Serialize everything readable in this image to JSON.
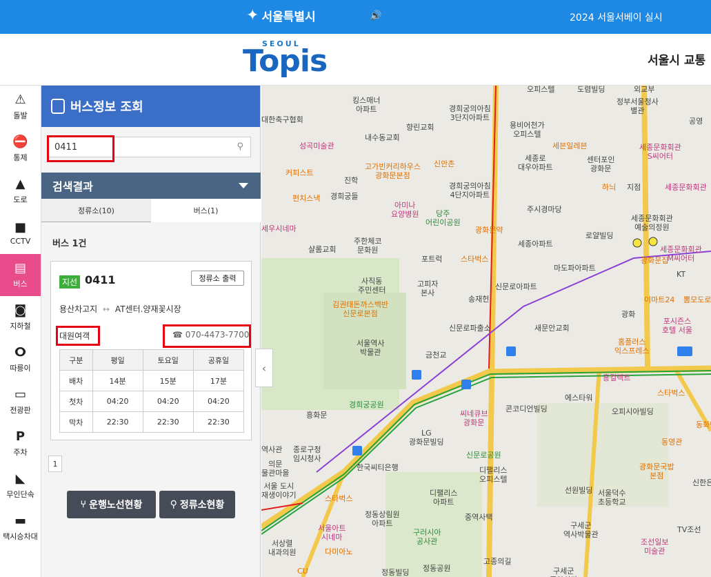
{
  "topbar": {
    "brand": "서울특별시",
    "notice": "2024 서울서베이 실시"
  },
  "header": {
    "logo_small": "SEOUL",
    "logo": "Topis",
    "site_title": "서울시 교통"
  },
  "nav": [
    {
      "label": "돌발",
      "icon": "alert-light-icon"
    },
    {
      "label": "통제",
      "icon": "no-entry-icon"
    },
    {
      "label": "도로",
      "icon": "road-icon"
    },
    {
      "label": "CCTV",
      "icon": "camera-icon"
    },
    {
      "label": "버스",
      "icon": "bus-icon"
    },
    {
      "label": "지하철",
      "icon": "subway-icon"
    },
    {
      "label": "따릉이",
      "icon": "bicycle-icon"
    },
    {
      "label": "전광판",
      "icon": "signboard-icon"
    },
    {
      "label": "주차",
      "icon": "parking-icon"
    },
    {
      "label": "무인단속",
      "icon": "speed-camera-icon"
    },
    {
      "label": "택시승차대",
      "icon": "taxi-icon"
    }
  ],
  "panel": {
    "title": "버스정보 조회",
    "search_value": "0411",
    "results_title": "검색결과",
    "tabs": [
      "정류소(10)",
      "버스(1)"
    ],
    "count": "버스 1건"
  },
  "route": {
    "type": "지선",
    "number": "0411",
    "stop_print": "정류소 출력",
    "start": "용산차고지",
    "arrow": "↔",
    "end": "AT센터.양재꽃시장",
    "company": "대원여객",
    "phone": "070-4473-7700",
    "schedule": {
      "headers": [
        "구분",
        "평일",
        "토요일",
        "공휴일"
      ],
      "rows": [
        [
          "배차",
          "14분",
          "15분",
          "17분"
        ],
        [
          "첫차",
          "04:20",
          "04:20",
          "04:20"
        ],
        [
          "막차",
          "22:30",
          "22:30",
          "22:30"
        ]
      ]
    }
  },
  "pager": {
    "current": "1"
  },
  "buttons": {
    "route_status": "운행노선현황",
    "stop_status": "정류소현황"
  },
  "map": {
    "labels": [
      {
        "text": "오피스텔",
        "class": ""
      },
      {
        "text": "도렴빌딩",
        "class": ""
      },
      {
        "text": "외교부",
        "class": ""
      },
      {
        "text": "킹스매너\n아파트",
        "class": ""
      },
      {
        "text": "경희궁의아침\n3단지아파트",
        "class": ""
      },
      {
        "text": "정부서울청사\n별관",
        "class": ""
      },
      {
        "text": "대한축구협회",
        "class": ""
      },
      {
        "text": "향린교회",
        "class": ""
      },
      {
        "text": "용비어천가\n오피스텔",
        "class": ""
      },
      {
        "text": "공영",
        "class": ""
      },
      {
        "text": "성곡미술관",
        "class": "pink"
      },
      {
        "text": "내수동교회",
        "class": ""
      },
      {
        "text": "세븐일레븐",
        "class": "orange"
      },
      {
        "text": "세종문화회관\nS씨어터",
        "class": "pink"
      },
      {
        "text": "커피스트",
        "class": "orange"
      },
      {
        "text": "고가빈커리하우스\n광화문본점",
        "class": "orange"
      },
      {
        "text": "신안촌",
        "class": "orange"
      },
      {
        "text": "세종로\n대우아파트",
        "class": ""
      },
      {
        "text": "센터포인\n광화문",
        "class": ""
      },
      {
        "text": "진학",
        "class": ""
      },
      {
        "text": "하늬",
        "class": "orange"
      },
      {
        "text": "지점",
        "class": ""
      },
      {
        "text": "세종문화회관",
        "class": "pink"
      },
      {
        "text": "펀치스낵",
        "class": "orange"
      },
      {
        "text": "경희궁들",
        "class": ""
      },
      {
        "text": "경희궁의아침\n4단지아파트",
        "class": ""
      },
      {
        "text": "아미나\n요양병원",
        "class": "pink"
      },
      {
        "text": "주시경마당",
        "class": ""
      },
      {
        "text": "당주\n어린이공원",
        "class": "green"
      },
      {
        "text": "세종문화회관\n예술의정원",
        "class": ""
      },
      {
        "text": "세우시네마",
        "class": "pink"
      },
      {
        "text": "샬롬교회",
        "class": ""
      },
      {
        "text": "주한체코\n문화원",
        "class": ""
      },
      {
        "text": "광화문약",
        "class": "orange"
      },
      {
        "text": "로얄빌딩",
        "class": ""
      },
      {
        "text": "세종아파트",
        "class": ""
      },
      {
        "text": "세종문화회관\nM씨어터",
        "class": "pink"
      },
      {
        "text": "포트럭",
        "class": ""
      },
      {
        "text": "스타벅스",
        "class": "orange"
      },
      {
        "text": "마도파아파트",
        "class": ""
      },
      {
        "text": "광화문집",
        "class": "orange"
      },
      {
        "text": "사직동\n주민센터",
        "class": ""
      },
      {
        "text": "고피자\n본사",
        "class": ""
      },
      {
        "text": "신문로아파트",
        "class": ""
      },
      {
        "text": "KT",
        "class": ""
      },
      {
        "text": "송재헌",
        "class": ""
      },
      {
        "text": "이마트24",
        "class": "orange"
      },
      {
        "text": "뽐모도로",
        "class": "orange"
      },
      {
        "text": "김권태돈까스백반\n신문로본점",
        "class": "orange"
      },
      {
        "text": "광화",
        "class": ""
      },
      {
        "text": "서울역사\n박물관",
        "class": ""
      },
      {
        "text": "신문로파출소",
        "class": ""
      },
      {
        "text": "새문안교회",
        "class": ""
      },
      {
        "text": "포시즌스\n호텔 서울",
        "class": "pink"
      },
      {
        "text": "홈플러스\n익스프레스",
        "class": "orange"
      },
      {
        "text": "금천교",
        "class": ""
      },
      {
        "text": "흥컬렉트",
        "class": "pink"
      },
      {
        "text": "스타벅스",
        "class": "orange"
      },
      {
        "text": "경희궁공원",
        "class": "green"
      },
      {
        "text": "씨네큐브\n광화문",
        "class": "pink"
      },
      {
        "text": "콘코디언빌딩",
        "class": ""
      },
      {
        "text": "에스타워",
        "class": ""
      },
      {
        "text": "오피시아빌딩",
        "class": ""
      },
      {
        "text": "흥화문",
        "class": ""
      },
      {
        "text": "LG\n광화문빌딩",
        "class": ""
      },
      {
        "text": "동화면",
        "class": "orange"
      },
      {
        "text": "동영관",
        "class": "orange"
      },
      {
        "text": "역사관",
        "class": ""
      },
      {
        "text": "종로구청\n임시청사",
        "class": ""
      },
      {
        "text": "한국씨티은행",
        "class": ""
      },
      {
        "text": "신문로공원",
        "class": "green"
      },
      {
        "text": "디팰리스\n오피스텔",
        "class": ""
      },
      {
        "text": "광화문국밥\n본점",
        "class": "orange"
      },
      {
        "text": "신한은",
        "class": ""
      },
      {
        "text": "의문\n물관마을",
        "class": ""
      },
      {
        "text": "서울 도시\n재생이야기",
        "class": ""
      },
      {
        "text": "스타벅스",
        "class": "orange"
      },
      {
        "text": "디팰리스\n아파트",
        "class": ""
      },
      {
        "text": "선원빌딩",
        "class": ""
      },
      {
        "text": "서울덕수\n초등학교",
        "class": ""
      },
      {
        "text": "정동상림원\n아파트",
        "class": ""
      },
      {
        "text": "중역사택",
        "class": ""
      },
      {
        "text": "서울아트\n시네마",
        "class": "pink"
      },
      {
        "text": "구러시아\n공사관",
        "class": "green"
      },
      {
        "text": "구세군\n역사박물관",
        "class": ""
      },
      {
        "text": "조선일보\n미술관",
        "class": "pink"
      },
      {
        "text": "TV조선",
        "class": ""
      },
      {
        "text": "서상렬\n내과의원",
        "class": ""
      },
      {
        "text": "다미아노",
        "class": "orange"
      },
      {
        "text": "고종의길",
        "class": ""
      },
      {
        "text": "CU",
        "class": "orange"
      },
      {
        "text": "정동공원",
        "class": ""
      },
      {
        "text": "정동빌딩",
        "class": ""
      },
      {
        "text": "구세군\n중앙회관",
        "class": ""
      }
    ]
  },
  "colors": {
    "topbar": "#1e88e5",
    "panel_header": "#3b6fc7",
    "results_header": "#4a6584",
    "active_nav": "#e84c8b",
    "highlight": "#e60012",
    "route_badge": "#3dae3d"
  }
}
